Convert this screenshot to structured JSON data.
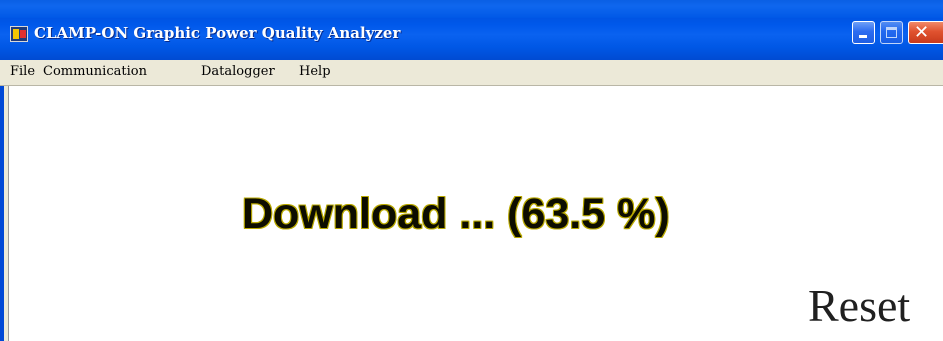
{
  "window": {
    "title": "CLAMP-ON Graphic Power Quality Analyzer",
    "icon": "app-icon"
  },
  "menu": {
    "items": [
      "File",
      "Communication",
      "Datalogger",
      "Help"
    ]
  },
  "main": {
    "status_text": "Download ... (63.5 %)",
    "download_progress_percent": 63.5,
    "reset_label": "Reset"
  },
  "colors": {
    "titlebar": "#0058e6",
    "menubar": "#ece9d8",
    "status_outline": "#b8a800",
    "close_button": "#e0522f"
  }
}
